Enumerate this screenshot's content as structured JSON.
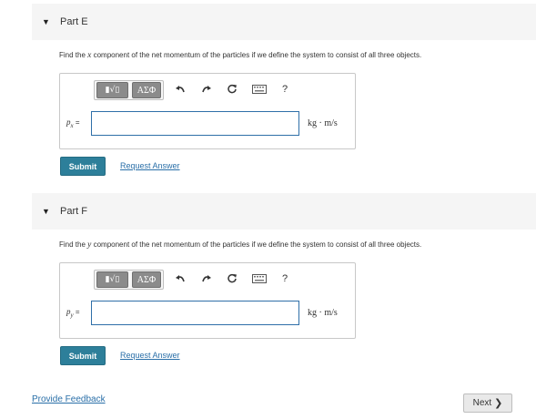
{
  "parts": [
    {
      "title": "Part E",
      "question_before": "Find the ",
      "variable": "x",
      "question_after": " component of the net momentum of the particles if we define the system to consist of all three objects.",
      "answer_label_base": "p",
      "answer_label_sub": "x",
      "answer_label_eq": " =",
      "answer_value": "",
      "unit": "kg · m/s",
      "submit_label": "Submit",
      "request_label": "Request Answer"
    },
    {
      "title": "Part F",
      "question_before": "Find the ",
      "variable": "y",
      "question_after": " component of the net momentum of the particles if we define the system to consist of all three objects.",
      "answer_label_base": "p",
      "answer_label_sub": "y",
      "answer_label_eq": " =",
      "answer_value": "",
      "unit": "kg · m/s",
      "submit_label": "Submit",
      "request_label": "Request Answer"
    }
  ],
  "toolbar": {
    "templates_label": "▮√▯",
    "symbols_label": "ΑΣΦ",
    "undo_icon": "undo-icon",
    "redo_icon": "redo-icon",
    "reset_icon": "reset-icon",
    "keyboard_icon": "keyboard-icon",
    "help_label": "?"
  },
  "footer": {
    "feedback_label": "Provide Feedback",
    "next_label": "Next",
    "next_chevron": "❯"
  },
  "colors": {
    "submit_bg": "#2d7f9a",
    "link": "#2a6fa8",
    "input_border": "#2f6fa8"
  }
}
